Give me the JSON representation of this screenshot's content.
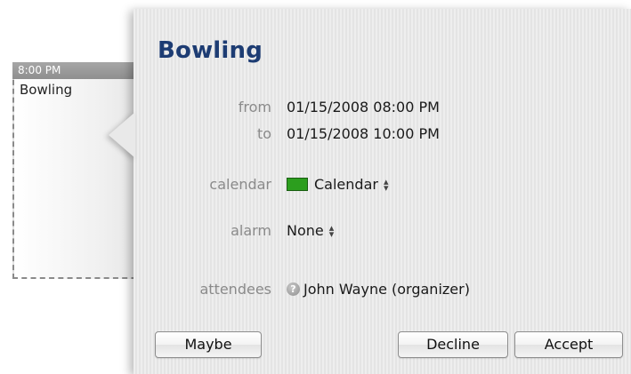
{
  "event_block": {
    "time": "8:00 PM",
    "title": "Bowling"
  },
  "popover": {
    "title": "Bowling",
    "from_label": "from",
    "from_value": "01/15/2008 08:00 PM",
    "to_label": "to",
    "to_value": "01/15/2008 10:00 PM",
    "calendar_label": "calendar",
    "calendar_value": "Calendar",
    "calendar_color": "#2c9e1e",
    "alarm_label": "alarm",
    "alarm_value": "None",
    "attendees_label": "attendees",
    "attendee_value": "John Wayne (organizer)",
    "attendee_icon": "help-icon"
  },
  "buttons": {
    "maybe": "Maybe",
    "decline": "Decline",
    "accept": "Accept"
  }
}
